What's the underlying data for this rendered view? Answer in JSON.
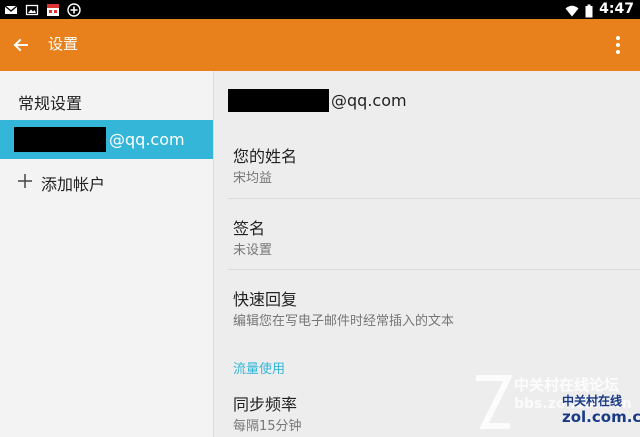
{
  "status_bar": {
    "icons_left": [
      "mail-icon",
      "image-icon",
      "calendar-icon",
      "sync-icon"
    ],
    "icons_right": [
      "wifi-icon",
      "battery-icon"
    ],
    "time": "4:47"
  },
  "app_bar": {
    "title": "设置",
    "color": "#e8811c"
  },
  "left_pane": {
    "header": "常规设置",
    "account_suffix": "@qq.com",
    "add_account": "添加帐户",
    "selected_color": "#33b6d8"
  },
  "right_pane": {
    "account_suffix": "@qq.com",
    "prefs": [
      {
        "title": "您的姓名",
        "summary": "宋均益"
      },
      {
        "title": "签名",
        "summary": "未设置"
      },
      {
        "title": "快速回复",
        "summary": "编辑您在写电子邮件时经常插入的文本"
      }
    ],
    "section_header": "流量使用",
    "sync": {
      "title": "同步频率",
      "summary": "每隔15分钟"
    }
  },
  "watermark": {
    "line1": "中关村在线论坛",
    "line2": "bbs.zol.com.cn",
    "logo_cn": "中关村在线",
    "logo_en": "zol.com.cn"
  }
}
